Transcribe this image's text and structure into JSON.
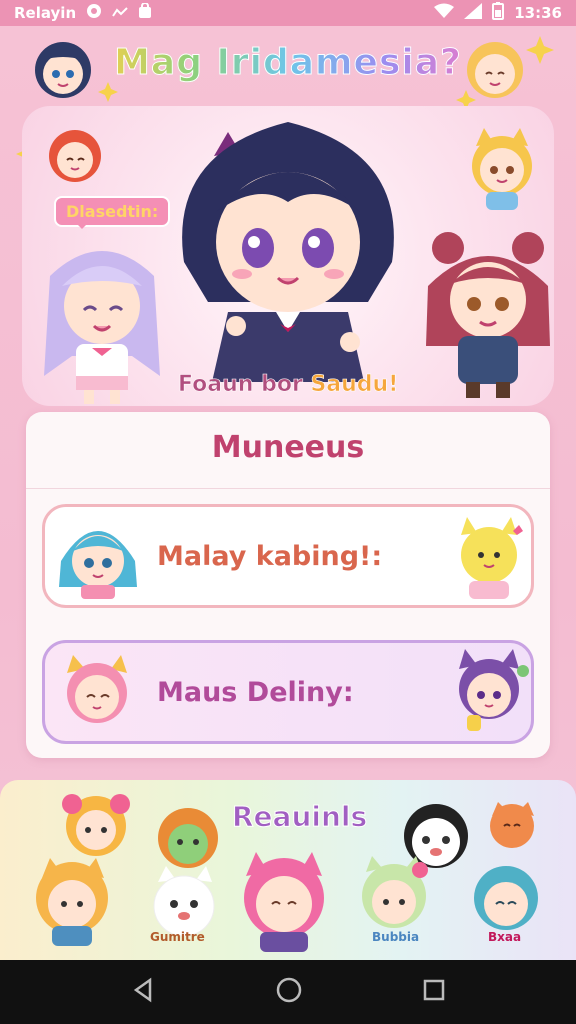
{
  "status_bar": {
    "left_text": "Relayin",
    "time": "13:36",
    "icons": [
      "circle-notification-icon",
      "signal-small-icon",
      "bag-icon",
      "wifi-icon",
      "signal-icon",
      "battery-icon"
    ]
  },
  "app": {
    "title": "Mag Iridamesia?",
    "hero": {
      "speech_label": "Dlasedtin:",
      "tagline_main": "Foaun bor ",
      "tagline_accent": "Saudu!"
    },
    "menu": {
      "title": "Muneeus",
      "items": [
        {
          "label": "Malay kabing!:"
        },
        {
          "label": "Maus Deliny:"
        }
      ]
    },
    "rewards": {
      "title": "Reauinls",
      "character_labels": [
        "Gumitre",
        "Bubbia",
        "Bxaa"
      ]
    }
  },
  "nav_bar": {
    "icons": [
      "back-icon",
      "home-icon",
      "recents-icon"
    ]
  },
  "colors": {
    "status_bar": "#ec93b4",
    "background": "#f6c2d5",
    "menu_title": "#c0426e",
    "button1_text": "#d9664d",
    "button2_text": "#b14b9a",
    "rewards_title": "#a15fc2"
  }
}
